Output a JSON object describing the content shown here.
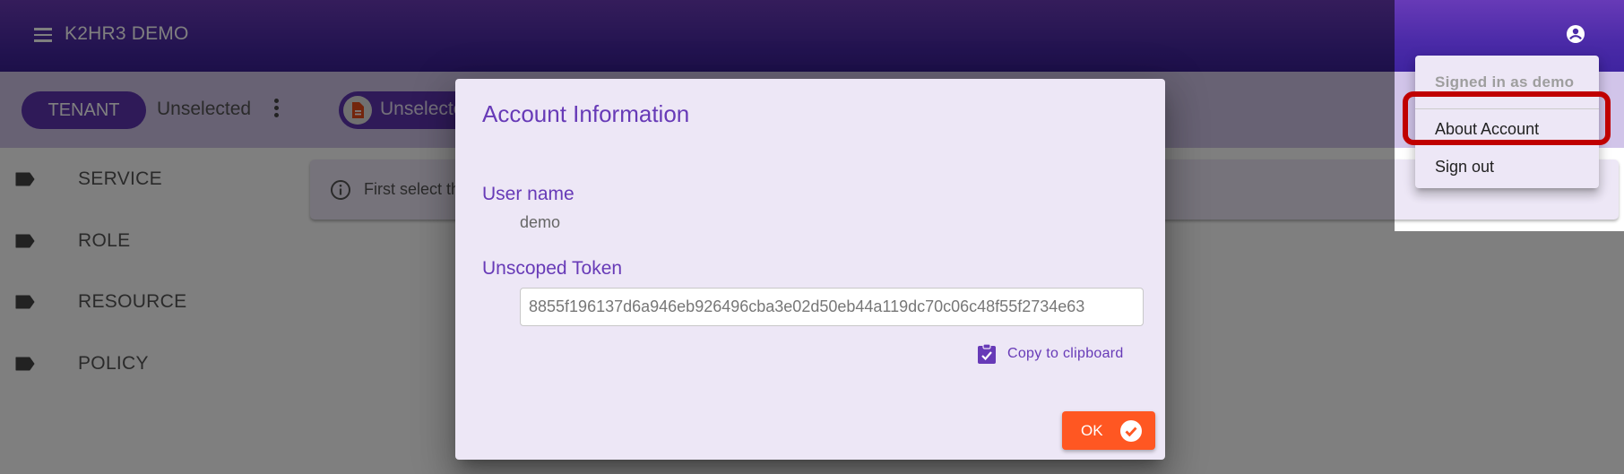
{
  "app": {
    "title": "K2HR3 DEMO"
  },
  "subbar": {
    "tenant_chip": "TENANT",
    "tenant_value": "Unselected",
    "service_chip": "Unselected"
  },
  "sidebar": {
    "items": [
      {
        "label": "SERVICE",
        "icon": "label-icon"
      },
      {
        "label": "ROLE",
        "icon": "label-icon"
      },
      {
        "label": "RESOURCE",
        "icon": "label-icon"
      },
      {
        "label": "POLICY",
        "icon": "label-icon"
      }
    ]
  },
  "main": {
    "info_text": "First select the tenant"
  },
  "dialog": {
    "title": "Account Information",
    "user_name_label": "User name",
    "user_name_value": "demo",
    "token_label": "Unscoped Token",
    "token_value": "8855f196137d6a946eb926496cba3e02d50eb44a119dc70c06c48f55f2734e63",
    "copy_label": "Copy to clipboard",
    "ok_label": "OK"
  },
  "account_menu": {
    "signed_in": "Signed in as demo",
    "items": [
      {
        "label": "About Account"
      },
      {
        "label": "Sign out"
      }
    ]
  },
  "colors": {
    "primary": "#673ab7",
    "accent": "#ff5722",
    "highlight": "#c00000"
  }
}
